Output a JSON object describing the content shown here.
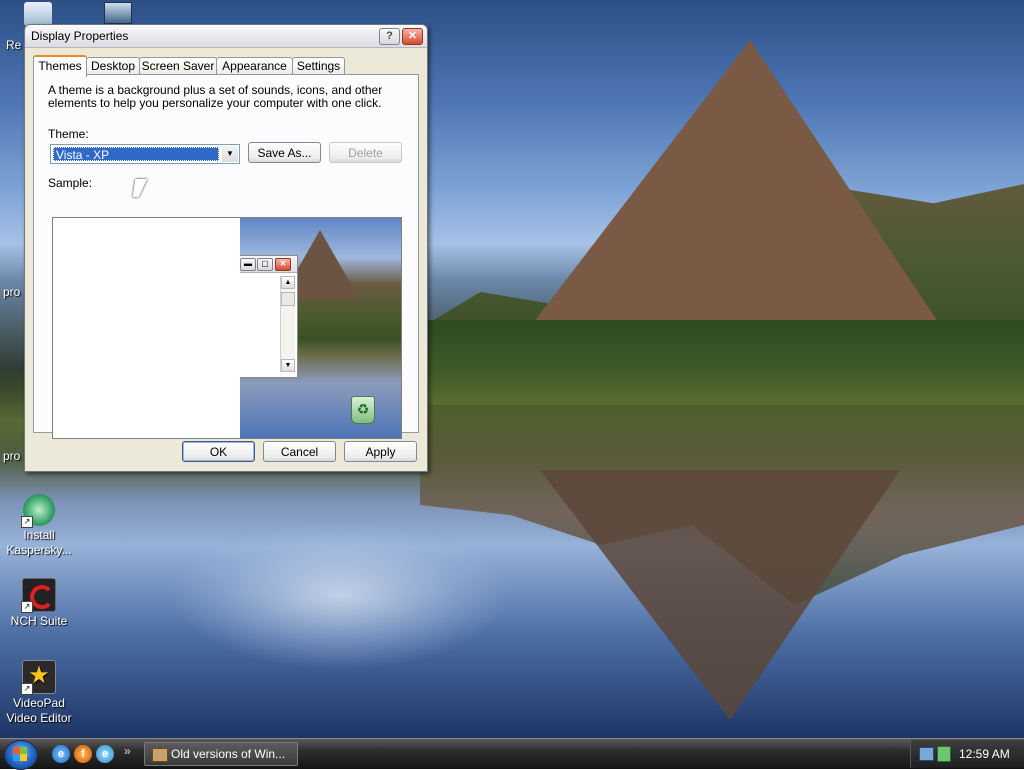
{
  "window": {
    "title": "Display Properties",
    "help_symbol": "?",
    "close_symbol": "✕",
    "tabs": [
      {
        "label": "Themes"
      },
      {
        "label": "Desktop"
      },
      {
        "label": "Screen Saver"
      },
      {
        "label": "Appearance"
      },
      {
        "label": "Settings"
      }
    ],
    "description": "A theme is a background plus a set of sounds, icons, and other elements to help you personalize your computer with one click.",
    "theme_label": "Theme:",
    "theme_value": "Vista - XP",
    "save_as_label": "Save As...",
    "delete_label": "Delete",
    "sample_label": "Sample:",
    "ok_label": "OK",
    "cancel_label": "Cancel",
    "apply_label": "Apply"
  },
  "desktop": {
    "icons": [
      {
        "label": "Install Kaspersky..."
      },
      {
        "label": "NCH Suite"
      },
      {
        "label": "VideoPad Video Editor"
      }
    ],
    "clipped_labels": [
      "Re",
      "pro",
      "pro"
    ]
  },
  "taskbar": {
    "task_button_label": "Old versions of Win...",
    "clock": "12:59 AM",
    "chevron": "»"
  },
  "icons": {
    "start": "windows-start-icon",
    "quicklaunch": [
      "internet-explorer-icon",
      "firefox-icon",
      "browser-icon"
    ],
    "tray": [
      "network-icon",
      "security-icon"
    ]
  }
}
